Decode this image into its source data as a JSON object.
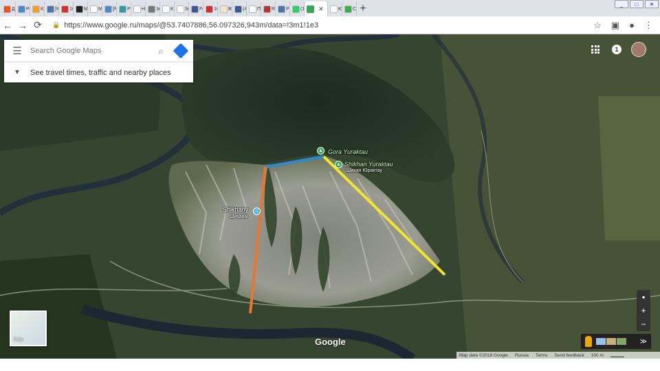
{
  "browser": {
    "tabs": [
      {
        "label": "Д",
        "color": "#e8571a",
        "icon": "dzen-icon"
      },
      {
        "label": "Ре",
        "color": "#4a8cc9",
        "icon": "gear-icon"
      },
      {
        "label": "Кэ",
        "color": "#f4a020",
        "icon": "note-icon"
      },
      {
        "label": "[К",
        "color": "#4a76a8",
        "icon": "vk-icon"
      },
      {
        "label": "1C",
        "color": "#d32f2f",
        "icon": "stop-icon"
      },
      {
        "label": "Mc",
        "color": "#222222",
        "icon": "m-icon"
      },
      {
        "label": "Mi",
        "color": "#ffffff",
        "icon": "doc-icon"
      },
      {
        "label": "[F",
        "color": "#4a8cc9",
        "icon": "s-icon"
      },
      {
        "label": "Pc",
        "color": "#2e9e9e",
        "icon": "jc-icon"
      },
      {
        "label": "Hc",
        "color": "#ffffff",
        "icon": "doc-icon"
      },
      {
        "label": "3c",
        "color": "#777777",
        "icon": "globe-icon"
      },
      {
        "label": "Ki",
        "color": "#ffffff",
        "icon": "wiki-icon"
      },
      {
        "label": "3c",
        "color": "#ffffff",
        "icon": "wiki-icon"
      },
      {
        "label": "Fc",
        "color": "#3b5998",
        "icon": "facebook-icon"
      },
      {
        "label": "1C",
        "color": "#d32f2f",
        "icon": "stop-icon"
      },
      {
        "label": "Bt",
        "color": "#f2e6c9",
        "icon": "note-icon"
      },
      {
        "label": "(4",
        "color": "#3b5998",
        "icon": "facebook-icon"
      },
      {
        "label": "Пс",
        "color": "#ffffff",
        "icon": "google-icon"
      },
      {
        "label": "Re",
        "color": "#b03a2e",
        "icon": "avatar-icon"
      },
      {
        "label": "Pi",
        "color": "#4a76a8",
        "icon": "vk-icon"
      },
      {
        "label": "(1",
        "color": "#25d366",
        "icon": "whatsapp-icon"
      }
    ],
    "active_tab": {
      "label": "",
      "close": "✕",
      "color": "#34a853"
    },
    "after_tabs": [
      {
        "label": "Ю",
        "color": "#ffffff",
        "icon": "wiki-icon"
      },
      {
        "label": "С",
        "color": "#3cb043",
        "icon": "puzzle-icon"
      }
    ],
    "new_tab": "+",
    "url": "https://www.google.ru/maps/@53.7407886,56.097326,943m/data=!3m1!1e3"
  },
  "maps": {
    "search_placeholder": "Search Google Maps",
    "travel_text": "See travel times, traffic and nearby places",
    "notification_count": "1",
    "logo": "Google",
    "map_thumb_label": "Map",
    "zoom_in": "+",
    "zoom_out": "−",
    "compass": "●",
    "expand": "≫",
    "footer": {
      "data": "Map data ©2018 Google",
      "country": "Russia",
      "terms": "Terms",
      "feedback": "Send feedback",
      "scale": "100 m"
    },
    "places": {
      "gora": "Gora Yuraktau",
      "shikhan": "Shikhan Yuraktau",
      "shikhan_ru": "Шихан Юрактау",
      "shikhany": "Shikhany",
      "shikhany_ru": "Шиханы"
    },
    "annotation_colors": {
      "blue": "#2a8bd1",
      "orange": "#e8762c",
      "yellow": "#f3e628"
    }
  }
}
